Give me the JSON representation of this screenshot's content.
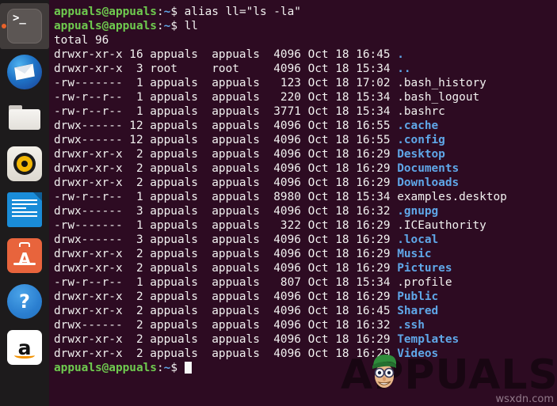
{
  "dock": {
    "items": [
      {
        "name": "terminal",
        "label": "Terminal",
        "glyph": ">_",
        "active": true
      },
      {
        "name": "thunderbird",
        "label": "Thunderbird Mail",
        "glyph": "",
        "active": false
      },
      {
        "name": "files",
        "label": "Files",
        "glyph": "",
        "active": false
      },
      {
        "name": "rhythmbox",
        "label": "Rhythmbox",
        "glyph": "",
        "active": false
      },
      {
        "name": "libreoffice-writer",
        "label": "LibreOffice Writer",
        "glyph": "",
        "active": false
      },
      {
        "name": "ubuntu-software",
        "label": "Ubuntu Software",
        "glyph": "A",
        "active": false
      },
      {
        "name": "help",
        "label": "Help",
        "glyph": "?",
        "active": false
      },
      {
        "name": "amazon",
        "label": "Amazon",
        "glyph": "a",
        "active": false
      }
    ]
  },
  "terminal": {
    "prompt": {
      "user_host": "appuals@appuals",
      "colon": ":",
      "path": "~",
      "dollar": "$"
    },
    "commands": [
      "alias ll=\"ls -la\"",
      "ll"
    ],
    "total_line": "total 96",
    "listing": [
      {
        "perms": "drwxr-xr-x",
        "links": "16",
        "owner": "appuals",
        "group": "appuals",
        "size": "4096",
        "month": "Oct",
        "day": "18",
        "time": "16:45",
        "name": ".",
        "type": "dir"
      },
      {
        "perms": "drwxr-xr-x",
        "links": " 3",
        "owner": "root",
        "group": "root",
        "size": "4096",
        "month": "Oct",
        "day": "18",
        "time": "15:34",
        "name": "..",
        "type": "dir"
      },
      {
        "perms": "-rw-------",
        "links": " 1",
        "owner": "appuals",
        "group": "appuals",
        "size": " 123",
        "month": "Oct",
        "day": "18",
        "time": "17:02",
        "name": ".bash_history",
        "type": "file"
      },
      {
        "perms": "-rw-r--r--",
        "links": " 1",
        "owner": "appuals",
        "group": "appuals",
        "size": " 220",
        "month": "Oct",
        "day": "18",
        "time": "15:34",
        "name": ".bash_logout",
        "type": "file"
      },
      {
        "perms": "-rw-r--r--",
        "links": " 1",
        "owner": "appuals",
        "group": "appuals",
        "size": "3771",
        "month": "Oct",
        "day": "18",
        "time": "15:34",
        "name": ".bashrc",
        "type": "file"
      },
      {
        "perms": "drwx------",
        "links": "12",
        "owner": "appuals",
        "group": "appuals",
        "size": "4096",
        "month": "Oct",
        "day": "18",
        "time": "16:55",
        "name": ".cache",
        "type": "dir"
      },
      {
        "perms": "drwx------",
        "links": "12",
        "owner": "appuals",
        "group": "appuals",
        "size": "4096",
        "month": "Oct",
        "day": "18",
        "time": "16:55",
        "name": ".config",
        "type": "dir"
      },
      {
        "perms": "drwxr-xr-x",
        "links": " 2",
        "owner": "appuals",
        "group": "appuals",
        "size": "4096",
        "month": "Oct",
        "day": "18",
        "time": "16:29",
        "name": "Desktop",
        "type": "dir"
      },
      {
        "perms": "drwxr-xr-x",
        "links": " 2",
        "owner": "appuals",
        "group": "appuals",
        "size": "4096",
        "month": "Oct",
        "day": "18",
        "time": "16:29",
        "name": "Documents",
        "type": "dir"
      },
      {
        "perms": "drwxr-xr-x",
        "links": " 2",
        "owner": "appuals",
        "group": "appuals",
        "size": "4096",
        "month": "Oct",
        "day": "18",
        "time": "16:29",
        "name": "Downloads",
        "type": "dir"
      },
      {
        "perms": "-rw-r--r--",
        "links": " 1",
        "owner": "appuals",
        "group": "appuals",
        "size": "8980",
        "month": "Oct",
        "day": "18",
        "time": "15:34",
        "name": "examples.desktop",
        "type": "file"
      },
      {
        "perms": "drwx------",
        "links": " 3",
        "owner": "appuals",
        "group": "appuals",
        "size": "4096",
        "month": "Oct",
        "day": "18",
        "time": "16:32",
        "name": ".gnupg",
        "type": "dir"
      },
      {
        "perms": "-rw-------",
        "links": " 1",
        "owner": "appuals",
        "group": "appuals",
        "size": " 322",
        "month": "Oct",
        "day": "18",
        "time": "16:29",
        "name": ".ICEauthority",
        "type": "file"
      },
      {
        "perms": "drwx------",
        "links": " 3",
        "owner": "appuals",
        "group": "appuals",
        "size": "4096",
        "month": "Oct",
        "day": "18",
        "time": "16:29",
        "name": ".local",
        "type": "dir"
      },
      {
        "perms": "drwxr-xr-x",
        "links": " 2",
        "owner": "appuals",
        "group": "appuals",
        "size": "4096",
        "month": "Oct",
        "day": "18",
        "time": "16:29",
        "name": "Music",
        "type": "dir"
      },
      {
        "perms": "drwxr-xr-x",
        "links": " 2",
        "owner": "appuals",
        "group": "appuals",
        "size": "4096",
        "month": "Oct",
        "day": "18",
        "time": "16:29",
        "name": "Pictures",
        "type": "dir"
      },
      {
        "perms": "-rw-r--r--",
        "links": " 1",
        "owner": "appuals",
        "group": "appuals",
        "size": " 807",
        "month": "Oct",
        "day": "18",
        "time": "15:34",
        "name": ".profile",
        "type": "file"
      },
      {
        "perms": "drwxr-xr-x",
        "links": " 2",
        "owner": "appuals",
        "group": "appuals",
        "size": "4096",
        "month": "Oct",
        "day": "18",
        "time": "16:29",
        "name": "Public",
        "type": "dir"
      },
      {
        "perms": "drwxr-xr-x",
        "links": " 2",
        "owner": "appuals",
        "group": "appuals",
        "size": "4096",
        "month": "Oct",
        "day": "18",
        "time": "16:45",
        "name": "Shared",
        "type": "dir"
      },
      {
        "perms": "drwx------",
        "links": " 2",
        "owner": "appuals",
        "group": "appuals",
        "size": "4096",
        "month": "Oct",
        "day": "18",
        "time": "16:32",
        "name": ".ssh",
        "type": "dir"
      },
      {
        "perms": "drwxr-xr-x",
        "links": " 2",
        "owner": "appuals",
        "group": "appuals",
        "size": "4096",
        "month": "Oct",
        "day": "18",
        "time": "16:29",
        "name": "Templates",
        "type": "dir"
      },
      {
        "perms": "drwxr-xr-x",
        "links": " 2",
        "owner": "appuals",
        "group": "appuals",
        "size": "4096",
        "month": "Oct",
        "day": "18",
        "time": "16:29",
        "name": "Videos",
        "type": "dir"
      }
    ]
  },
  "watermark": {
    "brand": "APPUALS",
    "site": "wsxdn.com"
  },
  "colors": {
    "terminal_bg": "#2d0b22",
    "dock_bg": "#1d1b1c",
    "prompt_green": "#6fcb4f",
    "dir_blue": "#5fa7e8",
    "text": "#f2f1f0",
    "accent_orange": "#e8622a"
  }
}
